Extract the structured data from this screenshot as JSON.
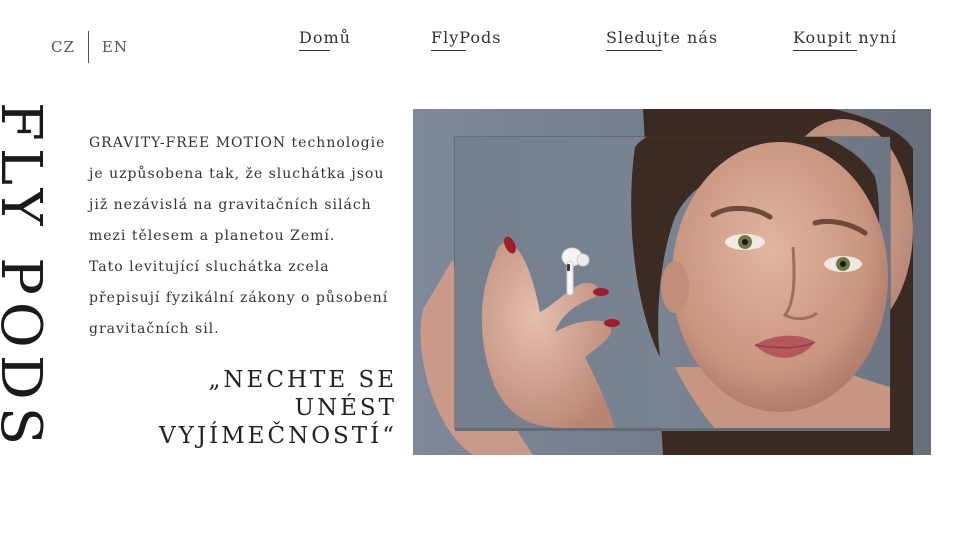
{
  "header": {
    "lang_cz": "CZ",
    "lang_en": "EN",
    "nav": [
      {
        "label": "Domů"
      },
      {
        "label": "FlyPods"
      },
      {
        "label": "Sledujte nás"
      },
      {
        "label": "Koupit nyní"
      }
    ]
  },
  "brand": {
    "vertical_title": "FLY PODS"
  },
  "main": {
    "desc_highlight": "GRAVITY-FREE MOTION",
    "desc_rest": " technologie je uzpůsobena tak, že sluchátka jsou již nezávislá na gravitačních silách mezi tělesem a planetou Zemí.",
    "desc_second": "Tato levitující sluchátka zcela přepisují fyzikální zákony o působení gravitačních sil.",
    "quote": "„NECHTE SE\nUNÉST\nVYJÍMEČNOSTÍ“"
  },
  "colors": {
    "text": "#2a2a2a",
    "photo_bg": "#7a8493",
    "lip": "#b5575d",
    "nail": "#a11d2a"
  }
}
